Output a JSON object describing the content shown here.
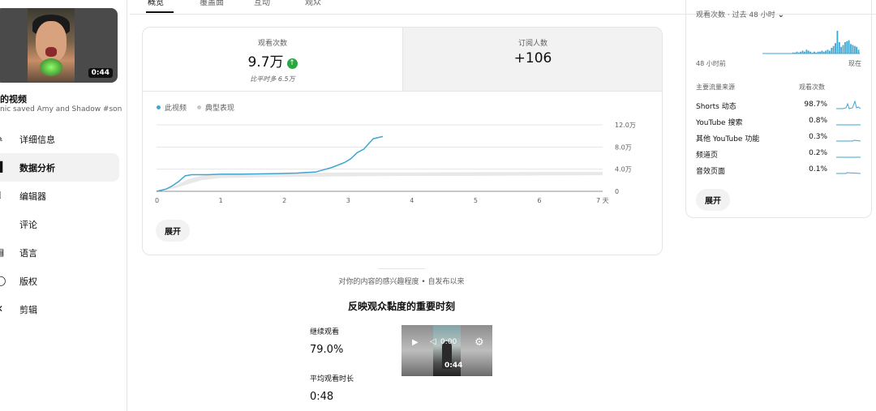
{
  "sidebar": {
    "video_duration": "0:44",
    "video_title": "的视频",
    "video_desc": "nic saved Amy and Shadow #soni...",
    "items": [
      {
        "label": "详细信息",
        "icon": "pencil-icon"
      },
      {
        "label": "数据分析",
        "icon": "analytics-icon"
      },
      {
        "label": "编辑器",
        "icon": "editor-icon"
      },
      {
        "label": "评论",
        "icon": "comment-icon"
      },
      {
        "label": "语言",
        "icon": "language-icon"
      },
      {
        "label": "版权",
        "icon": "copyright-icon"
      },
      {
        "label": "剪辑",
        "icon": "scissors-icon"
      }
    ]
  },
  "tabs": [
    "概览",
    "覆盖面",
    "互动",
    "观众"
  ],
  "stats": {
    "views_label": "观看次数",
    "views_value": "9.7万",
    "views_compare": "比平时多 6.5万",
    "subs_label": "订阅人数",
    "subs_value": "+106"
  },
  "legend": {
    "this_video": "此视频",
    "typical": "典型表现"
  },
  "chart_data": {
    "type": "line",
    "x_ticks": [
      "0",
      "1",
      "2",
      "3",
      "4",
      "5",
      "6",
      "7 天"
    ],
    "y_ticks": [
      "0",
      "4.0万",
      "8.0万",
      "12.0万"
    ],
    "xlim": [
      0,
      7
    ],
    "ylim": [
      0,
      12
    ],
    "y_unit": "万",
    "series": [
      {
        "name": "此视频",
        "color": "#3ea6d1",
        "x": [
          0,
          0.15,
          0.25,
          0.35,
          0.45,
          0.55,
          0.65,
          0.8,
          1.0,
          1.3,
          1.6,
          1.9,
          2.2,
          2.5,
          2.75,
          2.95,
          3.05,
          3.15,
          3.25,
          3.4,
          3.55
        ],
        "y": [
          0,
          0.4,
          1.0,
          1.8,
          2.8,
          3.0,
          3.0,
          3.0,
          3.1,
          3.1,
          3.15,
          3.2,
          3.3,
          3.5,
          4.3,
          5.2,
          5.9,
          7.0,
          7.6,
          9.5,
          9.9
        ]
      }
    ],
    "typical_band": {
      "name": "典型表现",
      "color": "#e8e8e8",
      "x": [
        0,
        0.3,
        0.5,
        0.7,
        1.0,
        2.0,
        3.0,
        4.0,
        5.0,
        6.0,
        7.0
      ],
      "low": [
        0,
        0.6,
        1.3,
        2.0,
        2.4,
        2.6,
        2.7,
        2.8,
        2.8,
        2.85,
        2.9
      ],
      "high": [
        0,
        1.0,
        2.2,
        2.8,
        3.2,
        3.3,
        3.4,
        3.4,
        3.45,
        3.5,
        3.5
      ]
    }
  },
  "expand_label": "展开",
  "right_panel": {
    "header": "观看次数 · 过去 48 小时",
    "axis_left": "48 小时前",
    "axis_right": "现在",
    "col_source": "主要流量来源",
    "col_views": "观看次数",
    "sparkline": [
      0,
      0,
      0,
      0,
      0,
      0,
      0,
      0,
      0,
      0,
      0,
      0,
      0,
      0,
      0,
      0,
      0,
      0,
      0,
      0,
      0,
      0,
      0,
      0,
      0,
      0,
      0,
      0,
      0,
      0,
      0,
      0,
      0,
      0,
      0,
      0,
      0,
      0,
      0,
      0,
      0,
      0,
      0,
      0,
      0,
      0,
      0,
      0,
      0,
      0,
      1,
      1,
      2,
      1,
      2,
      3,
      2,
      4,
      3,
      2,
      1,
      2,
      1,
      2,
      2,
      3,
      2,
      3,
      4,
      3,
      6,
      8,
      11,
      24,
      12,
      7,
      9,
      12,
      13,
      14,
      10,
      9,
      8,
      7,
      4
    ],
    "sources": [
      {
        "name": "Shorts 动态",
        "value": "98.7%"
      },
      {
        "name": "YouTube 搜索",
        "value": "0.8%"
      },
      {
        "name": "其他 YouTube 功能",
        "value": "0.3%"
      },
      {
        "name": "频道页",
        "value": "0.2%"
      },
      {
        "name": "音效页面",
        "value": "0.1%"
      }
    ]
  },
  "engagement": {
    "subtitle": "对你的内容的感兴趣程度 • 自发布以来",
    "title": "反映观众黏度的重要时刻",
    "continue_label": "继续观看",
    "continue_value": "79.0%",
    "avg_label": "平均观看时长",
    "avg_value": "0:48",
    "player_time": "0:00",
    "player_duration": "0:44"
  }
}
